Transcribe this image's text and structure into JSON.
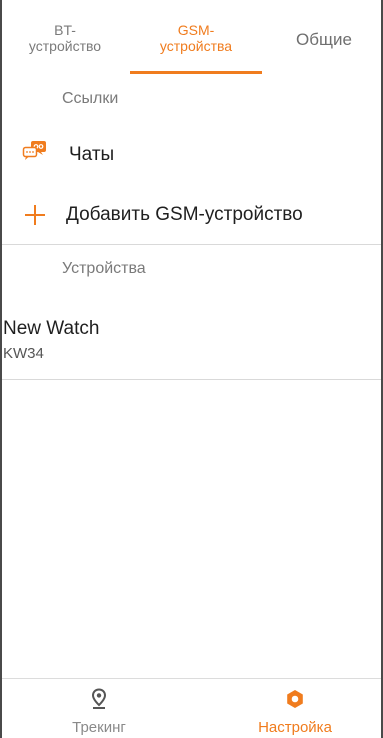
{
  "tabs": [
    {
      "line1": "BT-",
      "line2": "устройство"
    },
    {
      "line1": "GSM-",
      "line2": "устройства"
    },
    {
      "label": "Общие"
    }
  ],
  "links_header": "Ссылки",
  "chats_label": "Чаты",
  "add_device_label": "Добавить GSM-устройство",
  "devices_header": "Устройства",
  "device": {
    "name": "New Watch",
    "model": "KW34"
  },
  "bottom_nav": {
    "tracking": "Трекинг",
    "settings": "Настройка"
  },
  "colors": {
    "accent": "#f07c1e"
  },
  "icons": {
    "chats": "chat-bubbles-icon",
    "add": "plus-icon",
    "tracking": "location-pin-icon",
    "settings": "gear-icon"
  }
}
